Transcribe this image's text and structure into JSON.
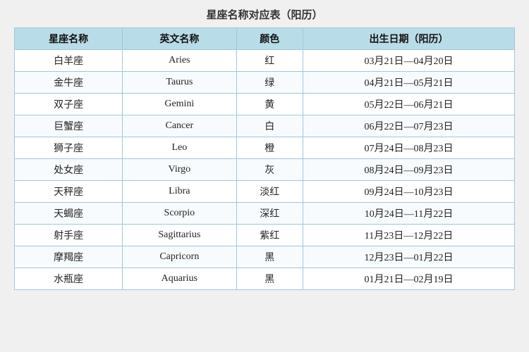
{
  "title": "星座名称对应表（阳历）",
  "table": {
    "headers": [
      "星座名称",
      "英文名称",
      "颜色",
      "出生日期（阳历）"
    ],
    "rows": [
      {
        "chinese": "白羊座",
        "english": "Aries",
        "color": "红",
        "date": "03月21日—04月20日"
      },
      {
        "chinese": "金牛座",
        "english": "Taurus",
        "color": "绿",
        "date": "04月21日—05月21日"
      },
      {
        "chinese": "双子座",
        "english": "Gemini",
        "color": "黄",
        "date": "05月22日—06月21日"
      },
      {
        "chinese": "巨蟹座",
        "english": "Cancer",
        "color": "白",
        "date": "06月22日—07月23日"
      },
      {
        "chinese": "狮子座",
        "english": "Leo",
        "color": "橙",
        "date": "07月24日—08月23日"
      },
      {
        "chinese": "处女座",
        "english": "Virgo",
        "color": "灰",
        "date": "08月24日—09月23日"
      },
      {
        "chinese": "天秤座",
        "english": "Libra",
        "color": "淡红",
        "date": "09月24日—10月23日"
      },
      {
        "chinese": "天蝎座",
        "english": "Scorpio",
        "color": "深红",
        "date": "10月24日—11月22日"
      },
      {
        "chinese": "射手座",
        "english": "Sagittarius",
        "color": "紫红",
        "date": "11月23日—12月22日"
      },
      {
        "chinese": "摩羯座",
        "english": "Capricorn",
        "color": "黑",
        "date": "12月23日—01月22日"
      },
      {
        "chinese": "水瓶座",
        "english": "Aquarius",
        "color": "黑",
        "date": "01月21日—02月19日"
      }
    ]
  }
}
